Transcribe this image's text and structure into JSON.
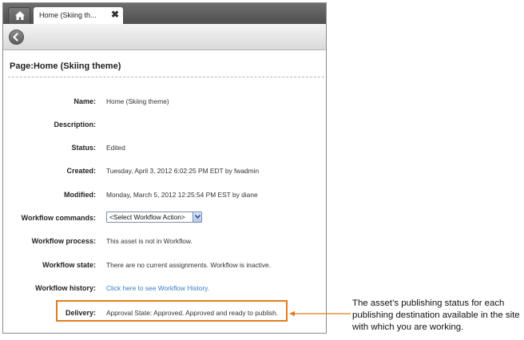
{
  "tabs": {
    "home_icon": "home-icon",
    "active_tab_label": "Home (Skiing th...",
    "close_glyph": "✖"
  },
  "toolbar": {
    "back_icon": "back-arrow-icon"
  },
  "page": {
    "title": "Page:Home (Skiing theme)"
  },
  "fields": {
    "name_label": "Name:",
    "name_value": "Home (Skiing theme)",
    "description_label": "Description:",
    "description_value": "",
    "status_label": "Status:",
    "status_value": "Edited",
    "created_label": "Created:",
    "created_value": "Tuesday, April 3, 2012 6:02:25 PM EDT by fwadmin",
    "modified_label": "Modified:",
    "modified_value": "Monday, March 5, 2012 12:25:54 PM EST by diane",
    "workflow_commands_label": "Workflow commands:",
    "workflow_commands_selected": "<Select Workflow Action>",
    "workflow_process_label": "Workflow process:",
    "workflow_process_value": "This asset is not in Workflow.",
    "workflow_state_label": "Workflow state:",
    "workflow_state_value": "There are no current assignments. Workflow is inactive.",
    "workflow_history_label": "Workflow history:",
    "workflow_history_link": "Click here to see Workflow History.",
    "delivery_label": "Delivery:",
    "delivery_value": "Approval State: Approved. Approved and ready to publish."
  },
  "callout": {
    "text": "The asset’s publishing status for each publishing destination available in the site with which you are working."
  },
  "colors": {
    "highlight": "#e27c1f",
    "link": "#3a7fc1"
  }
}
